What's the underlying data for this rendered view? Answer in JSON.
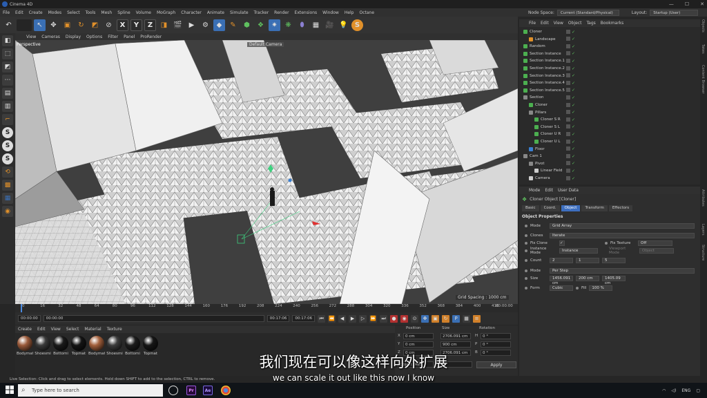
{
  "window": {
    "title": "Cinema 4D",
    "controls": [
      "—",
      "☐",
      "✕"
    ]
  },
  "menubar": {
    "items": [
      "File",
      "Edit",
      "Create",
      "Modes",
      "Select",
      "Tools",
      "Mesh",
      "Spline",
      "Volume",
      "MoGraph",
      "Character",
      "Animate",
      "Simulate",
      "Tracker",
      "Render",
      "Extensions",
      "Window",
      "Help",
      "Octane"
    ],
    "node_space_label": "Node Space:",
    "node_space_value": "Current (Standard/Physical)",
    "layout_label": "Layout:",
    "layout_value": "Startup (User)"
  },
  "viewport": {
    "menu": [
      "View",
      "Cameras",
      "Display",
      "Options",
      "Filter",
      "Panel",
      "ProRender"
    ],
    "label": "Perspective",
    "camera": "Default Camera",
    "grid_spacing": "Grid Spacing : 1000 cm"
  },
  "timeline": {
    "ticks": [
      "0",
      "16",
      "32",
      "48",
      "64",
      "80",
      "96",
      "112",
      "128",
      "144",
      "160",
      "176",
      "192",
      "208",
      "224",
      "240",
      "256",
      "272",
      "288",
      "304",
      "320",
      "336",
      "352",
      "368",
      "384",
      "400",
      "416"
    ],
    "end_frame": "00:00:00",
    "current": "00:00:00",
    "start": "00:00:00",
    "end_a": "00:17:06",
    "end_b": "00:17:06"
  },
  "materials": {
    "menu": [
      "Create",
      "Edit",
      "View",
      "Select",
      "Material",
      "Texture"
    ],
    "items": [
      {
        "name": "Bodymat",
        "color": "#9a5a3a"
      },
      {
        "name": "Shoesmi",
        "color": "#3a3a3a"
      },
      {
        "name": "Bottomi",
        "color": "#1a1a1a"
      },
      {
        "name": "Topmat",
        "color": "#141414"
      },
      {
        "name": "Bodymat",
        "color": "#a3603c"
      },
      {
        "name": "Shoesmi",
        "color": "#3c3c3c"
      },
      {
        "name": "Bottomi",
        "color": "#1c1c1c"
      },
      {
        "name": "Topmat",
        "color": "#161616"
      }
    ]
  },
  "coords": {
    "headers": [
      "Position",
      "Size",
      "Rotation"
    ],
    "rows": [
      {
        "axis": "X",
        "pos": "0 cm",
        "size": "2706.091 cm",
        "rot_label": "H",
        "rot": "0 °"
      },
      {
        "axis": "Y",
        "pos": "0 cm",
        "size": "900 cm",
        "rot_label": "P",
        "rot": "0 °"
      },
      {
        "axis": "Z",
        "pos": "0 cm",
        "size": "2706.091 cm",
        "rot_label": "B",
        "rot": "0 °"
      }
    ],
    "mode_a": "Object (Rel)",
    "mode_b": "Size",
    "apply": "Apply"
  },
  "status": "Live Selection: Click and drag to select elements. Hold down SHIFT to add to the selection, CTRL to remove.",
  "subtitle": {
    "cn": "我们现在可以像这样向外扩展",
    "en": "we can scale it out like this now I know"
  },
  "object_manager": {
    "menu": [
      "File",
      "Edit",
      "View",
      "Object",
      "Tags",
      "Bookmarks"
    ],
    "objects": [
      {
        "name": "Cloner",
        "indent": 0,
        "color": "#4caf50",
        "sel": false
      },
      {
        "name": "Landscape",
        "indent": 1,
        "color": "#e0902a",
        "sel": false
      },
      {
        "name": "Random",
        "indent": 0,
        "color": "#4caf50",
        "sel": false
      },
      {
        "name": "Section Instance",
        "indent": 0,
        "color": "#4caf50",
        "sel": false
      },
      {
        "name": "Section Instance.1",
        "indent": 0,
        "color": "#4caf50",
        "sel": false
      },
      {
        "name": "Section Instance.2",
        "indent": 0,
        "color": "#4caf50",
        "sel": false
      },
      {
        "name": "Section Instance.3",
        "indent": 0,
        "color": "#4caf50",
        "sel": false
      },
      {
        "name": "Section Instance.4",
        "indent": 0,
        "color": "#4caf50",
        "sel": false
      },
      {
        "name": "Section Instance.5",
        "indent": 0,
        "color": "#4caf50",
        "sel": false
      },
      {
        "name": "Section",
        "indent": 0,
        "color": "#888",
        "sel": false
      },
      {
        "name": "Cloner",
        "indent": 1,
        "color": "#4caf50",
        "sel": false
      },
      {
        "name": "Pillars",
        "indent": 1,
        "color": "#888",
        "sel": false
      },
      {
        "name": "Cloner S R",
        "indent": 2,
        "color": "#4caf50",
        "sel": false
      },
      {
        "name": "Cloner S L",
        "indent": 2,
        "color": "#4caf50",
        "sel": false
      },
      {
        "name": "Cloner U R",
        "indent": 2,
        "color": "#4caf50",
        "sel": false
      },
      {
        "name": "Cloner U L",
        "indent": 2,
        "color": "#4caf50",
        "sel": false
      },
      {
        "name": "Floor",
        "indent": 1,
        "color": "#3a7fd0",
        "sel": false
      },
      {
        "name": "Cam 1",
        "indent": 0,
        "color": "#888",
        "sel": false
      },
      {
        "name": "Pivot",
        "indent": 1,
        "color": "#888",
        "sel": false
      },
      {
        "name": "Linear Field",
        "indent": 2,
        "color": "#ccc",
        "sel": false
      },
      {
        "name": "Camera",
        "indent": 1,
        "color": "#ccc",
        "sel": false
      }
    ]
  },
  "attributes": {
    "menu": [
      "Mode",
      "Edit",
      "User Data"
    ],
    "title": "Cloner Object [Cloner]",
    "tabs": [
      "Basic",
      "Coord.",
      "Object",
      "Transform",
      "Effectors"
    ],
    "active_tab": "Object",
    "section": "Object Properties",
    "mode_label": "Mode",
    "mode_value": "Grid Array",
    "clones_label": "Clones",
    "clones_value": "Iterate",
    "fix_clone_label": "Fix Clone",
    "fix_texture_label": "Fix Texture",
    "fix_texture_value": "Off",
    "instance_mode_label": "Instance Mode",
    "instance_mode_value": "Instance",
    "viewport_mode_label": "Viewport Mode",
    "viewport_mode_value": "Object",
    "count_label": "Count",
    "count": [
      "2",
      "1",
      "5"
    ],
    "mode2_label": "Mode",
    "mode2_value": "Per Step",
    "size_label": "Size",
    "size": [
      "1456.091 cm",
      "200 cm",
      "1405.09 cm"
    ],
    "form_label": "Form",
    "form_value": "Cubic",
    "fill_label": "Fill",
    "fill_value": "100 %"
  },
  "side_tabs": [
    "Objects",
    "Takes",
    "Content Browser",
    "Attributes",
    "Layers",
    "Structure"
  ],
  "taskbar": {
    "search_placeholder": "Type here to search",
    "lang": "ENG",
    "apps": [
      "Pr",
      "Ae"
    ]
  }
}
